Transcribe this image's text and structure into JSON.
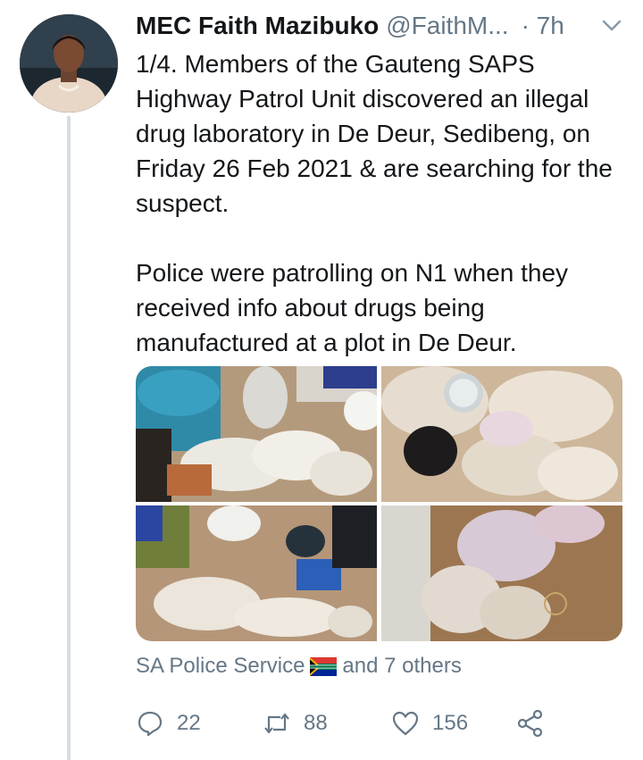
{
  "tweet": {
    "author_name": "MEC Faith Mazibuko",
    "handle": "@FaithM...",
    "time": "· 7h",
    "paragraphs": [
      "1/4. Members of the Gauteng SAPS Highway Patrol Unit discovered an illegal drug laboratory in De Deur, Sedibeng, on Friday 26 Feb 2021 & are searching for the suspect.",
      "Police were patrolling on N1 when they received info about drugs being manufactured at a plot in De Deur."
    ],
    "liked_by": {
      "name": "SA Police Service",
      "others": "and 7 others"
    },
    "actions": {
      "replies": "22",
      "retweets": "88",
      "likes": "156"
    }
  },
  "icons": [
    "chevron-down-icon",
    "reply-icon",
    "retweet-icon",
    "like-icon",
    "share-icon",
    "south-africa-flag-icon"
  ],
  "colors": {
    "text": "#14171a",
    "secondary": "#657786",
    "thread_line": "#d6dde3"
  }
}
